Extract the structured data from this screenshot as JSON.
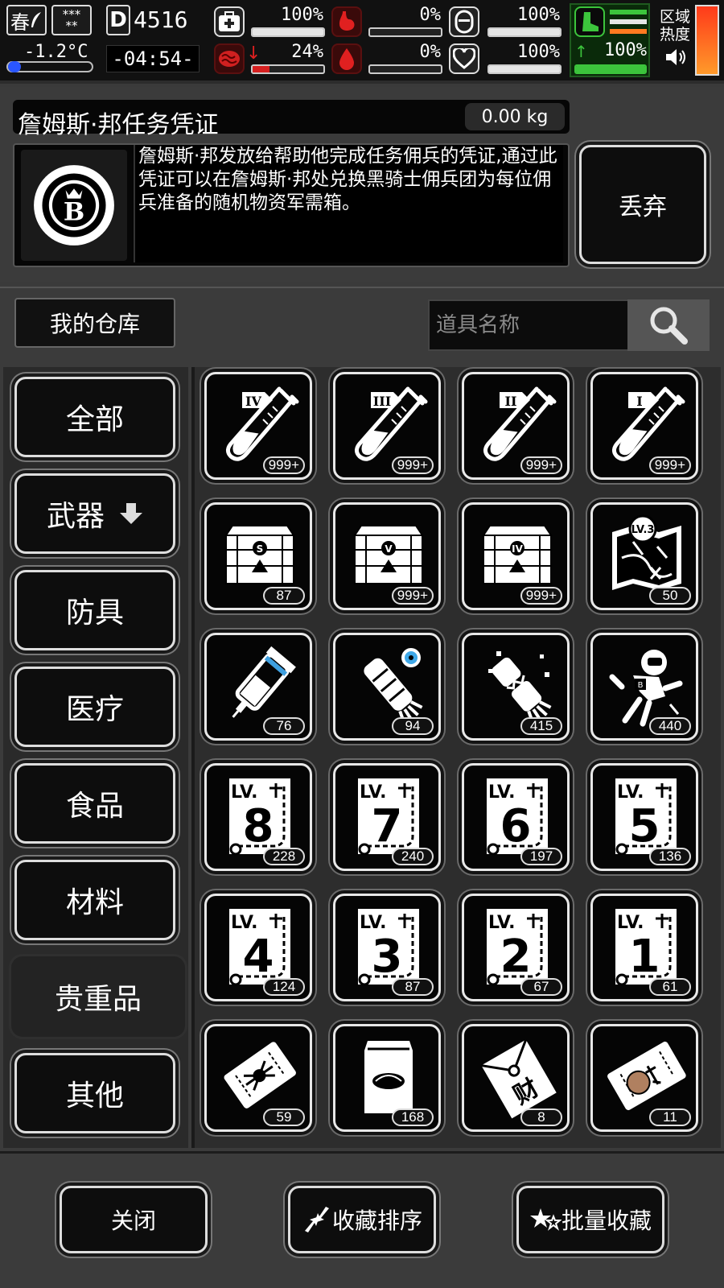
{
  "status": {
    "season": "春",
    "weather": "***\n**",
    "temperature": "-1.2°C",
    "day": "4516",
    "time": "-04:54-",
    "health_pct": "100%",
    "stomach_pct": "0%",
    "energy_pct": "100%",
    "infection_pct": "24%",
    "blood_pct": "0%",
    "mood_pct": "100%",
    "stamina_pct": "100%",
    "zone_heat_label": "区域热度",
    "zone_heat_label_line1": "区域",
    "zone_heat_label_line2": "热度",
    "levels": {
      "health": 1.0,
      "stomach": 0.0,
      "energy": 1.0,
      "infection": 0.24,
      "blood": 0.0,
      "mood": 1.0,
      "stamina": 1.0
    },
    "colors": {
      "danger": "#d62020",
      "good": "#3cc43c",
      "heat": "#ff6a00"
    }
  },
  "item_detail": {
    "title": "詹姆斯·邦任务凭证",
    "weight": "0.00 kg",
    "icon": "james-bond-token-icon",
    "description": "詹姆斯·邦发放给帮助他完成任务佣兵的凭证,通过此凭证可以在詹姆斯·邦处兑换黑骑士佣兵团为每位佣兵准备的随机物资军需箱。",
    "discard_label": "丢弃"
  },
  "warehouse": {
    "label": "我的仓库",
    "search_placeholder": "道具名称",
    "search_icon": "magnifier-icon"
  },
  "categories": [
    {
      "label": "全部"
    },
    {
      "label": "武器",
      "icon": "arrow-down-icon"
    },
    {
      "label": "防具"
    },
    {
      "label": "医疗"
    },
    {
      "label": "食品"
    },
    {
      "label": "材料"
    },
    {
      "label": "贵重品",
      "active": true
    },
    {
      "label": "其他"
    }
  ],
  "items": [
    {
      "icon": "test-tube-iv-icon",
      "tier": "IV",
      "count": "999+"
    },
    {
      "icon": "test-tube-iii-icon",
      "tier": "III",
      "count": "999+"
    },
    {
      "icon": "test-tube-ii-icon",
      "tier": "II",
      "count": "999+"
    },
    {
      "icon": "test-tube-i-icon",
      "tier": "I",
      "count": "999+"
    },
    {
      "icon": "supply-crate-s-icon",
      "tier": "S",
      "count": "87"
    },
    {
      "icon": "supply-crate-v-icon",
      "tier": "V",
      "count": "999+"
    },
    {
      "icon": "supply-crate-iv-icon",
      "tier": "IV",
      "count": "999+"
    },
    {
      "icon": "treasure-map-icon",
      "tier": "LV.3",
      "count": "50"
    },
    {
      "icon": "injector-icon",
      "count": "76"
    },
    {
      "icon": "cyber-arm-icon",
      "count": "94"
    },
    {
      "icon": "broken-arm-icon",
      "count": "415"
    },
    {
      "icon": "astronaut-icon",
      "count": "440"
    },
    {
      "icon": "level-ticket-icon",
      "level": "8",
      "count": "228"
    },
    {
      "icon": "level-ticket-icon",
      "level": "7",
      "count": "240"
    },
    {
      "icon": "level-ticket-icon",
      "level": "6",
      "count": "197"
    },
    {
      "icon": "level-ticket-icon",
      "level": "5",
      "count": "136"
    },
    {
      "icon": "level-ticket-icon",
      "level": "4",
      "count": "124"
    },
    {
      "icon": "level-ticket-icon",
      "level": "3",
      "count": "87"
    },
    {
      "icon": "level-ticket-icon",
      "level": "2",
      "count": "67"
    },
    {
      "icon": "level-ticket-icon",
      "level": "1",
      "count": "61"
    },
    {
      "icon": "spider-ticket-icon",
      "count": "59"
    },
    {
      "icon": "food-bag-icon",
      "count": "168"
    },
    {
      "icon": "fortune-packet-icon",
      "glyph": "财",
      "count": "8"
    },
    {
      "icon": "portrait-ticket-icon",
      "count": "11"
    }
  ],
  "footer": {
    "close_label": "关闭",
    "sort_label": "收藏排序",
    "sort_icon": "swap-arrows-icon",
    "batch_label": "批量收藏",
    "batch_icon": "stars-icon"
  },
  "level_ticket_prefix": "LV."
}
